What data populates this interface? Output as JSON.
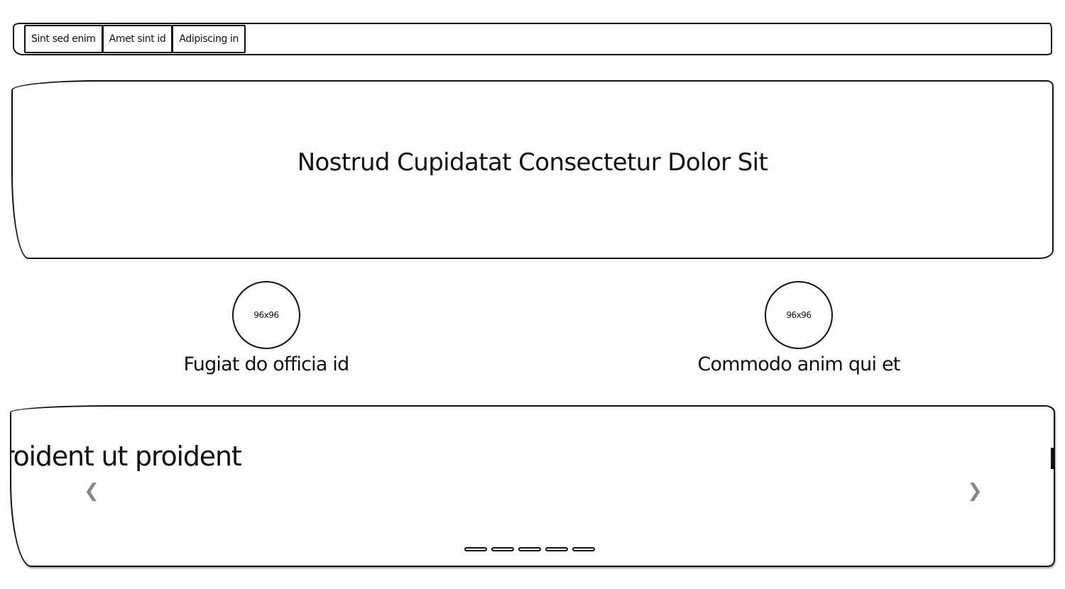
{
  "nav": {
    "tabs": [
      {
        "label": "Sint sed enim"
      },
      {
        "label": "Amet sint id"
      },
      {
        "label": "Adipiscing in"
      }
    ]
  },
  "hero": {
    "title": "Nostrud Cupidatat Consectetur Dolor Sit"
  },
  "features": [
    {
      "image_label": "96x96",
      "caption": "Fugiat do officia id"
    },
    {
      "image_label": "96x96",
      "caption": "Commodo anim qui et"
    }
  ],
  "carousel": {
    "slide_text": "proident ut proident",
    "prev_icon": "chevron-left-icon",
    "next_icon": "chevron-right-icon",
    "prev_glyph": "❮",
    "next_glyph": "❯",
    "indicator_count": 5
  }
}
